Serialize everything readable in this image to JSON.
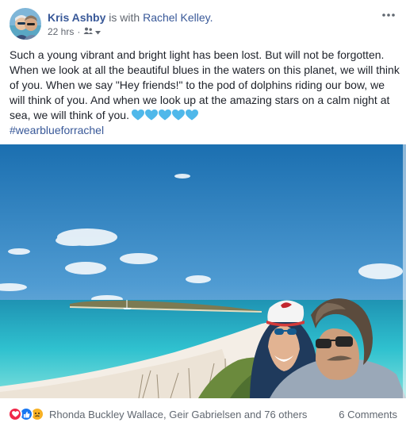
{
  "post": {
    "author": "Kris Ashby",
    "with_text": "is with",
    "tagged_user": "Rachel Kelley.",
    "time": "22 hrs",
    "separator": "·",
    "caption": "Such a young vibrant and bright light has been lost. But will not be forgotten. When we look at all the beautiful blues in the waters on this planet, we will think of you. When we say \"Hey friends!\" to the pod of dolphins riding our bow, we will think of you. And when we look up at the amazing stars on a calm night at sea, we will think of you.",
    "hashtag": "#wearblueforrachel"
  },
  "icons": {
    "more": "more-options-icon",
    "audience": "friends-audience-icon",
    "emoji": "blue-heart-emoji",
    "reactions": [
      "love-reaction-icon",
      "like-reaction-icon",
      "sad-reaction-icon"
    ]
  },
  "footer": {
    "reaction_names": "Rhonda Buckley Wallace, Geir Gabrielsen and 76 others",
    "comments": "6 Comments"
  },
  "colors": {
    "link": "#385898",
    "secondary_text": "#616770",
    "heart_emoji": "#4fb8ea",
    "love": "#f0284a",
    "like": "#1877f2",
    "sad": "#f7b125"
  }
}
